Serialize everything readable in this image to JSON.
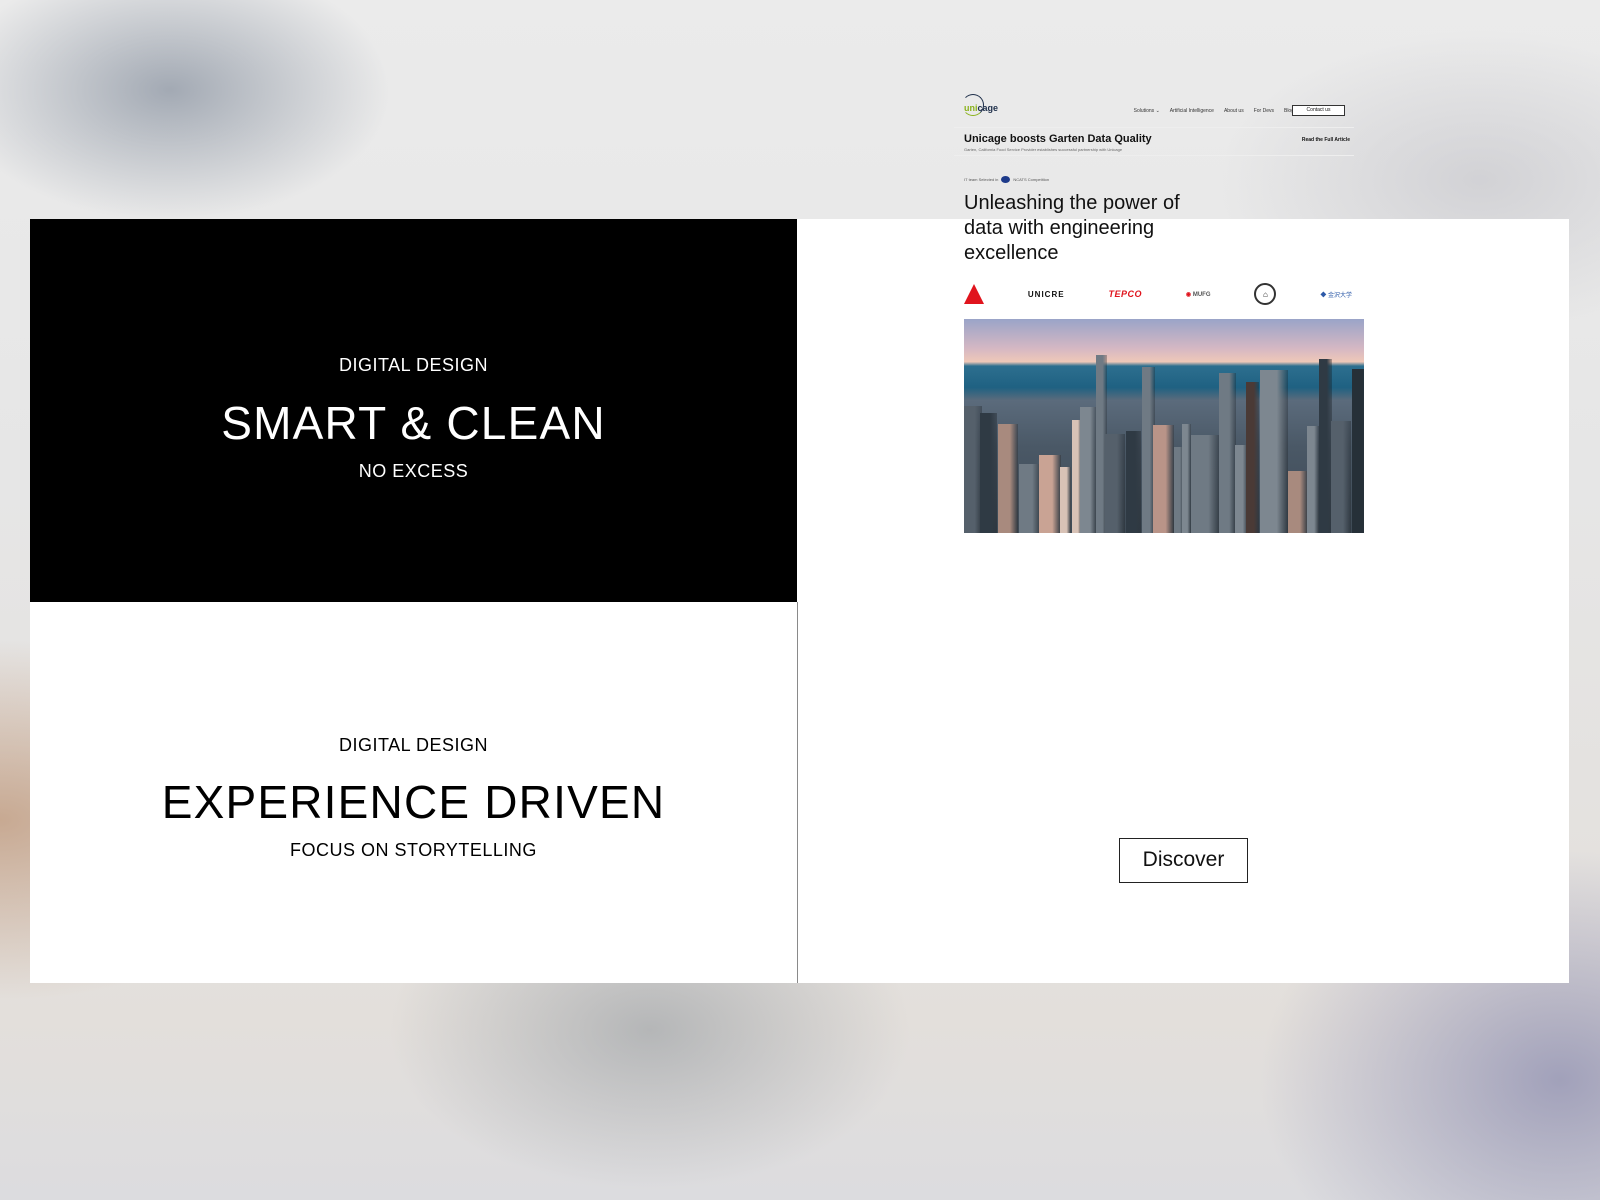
{
  "left_panels": [
    {
      "theme": "dark",
      "eyebrow": "DIGITAL DESIGN",
      "headline": "SMART & CLEAN",
      "subline": "NO EXCESS"
    },
    {
      "theme": "light",
      "eyebrow": "DIGITAL DESIGN",
      "headline": "EXPERIENCE DRIVEN",
      "subline": "FOCUS ON STORYTELLING"
    }
  ],
  "mockup": {
    "logo": {
      "part1": "uni",
      "part2": "cage"
    },
    "nav": {
      "items": [
        "Solutions ⌄",
        "Artificial Intelligence",
        "About us",
        "For Devs",
        "Blog"
      ],
      "cta": "Contact us"
    },
    "banner": {
      "title": "Unicage boosts Garten Data Quality",
      "subtitle": "Garten, California Food Service Provider establishes successful partnership with Unicage",
      "link": "Read the Full Article"
    },
    "badge": {
      "prefix": "IT team Selected in",
      "suffix": "NCATS Competition"
    },
    "hero_title": "Unleashing the power of data with engineering excellence",
    "client_logos": [
      {
        "name": "delta",
        "label": "Delta"
      },
      {
        "name": "unicre",
        "label": "UNICRE"
      },
      {
        "name": "tepco",
        "label": "TEPCO"
      },
      {
        "name": "mufg",
        "label": "MUFG"
      },
      {
        "name": "seal",
        "label": ""
      },
      {
        "name": "kanazawa",
        "label": "金沢大学"
      }
    ],
    "hero_image": "city-skyline"
  },
  "discover_button": "Discover",
  "colors": {
    "accent_red": "#e0141d",
    "logo_green": "#8ab21b",
    "logo_navy": "#1e2f4a"
  }
}
